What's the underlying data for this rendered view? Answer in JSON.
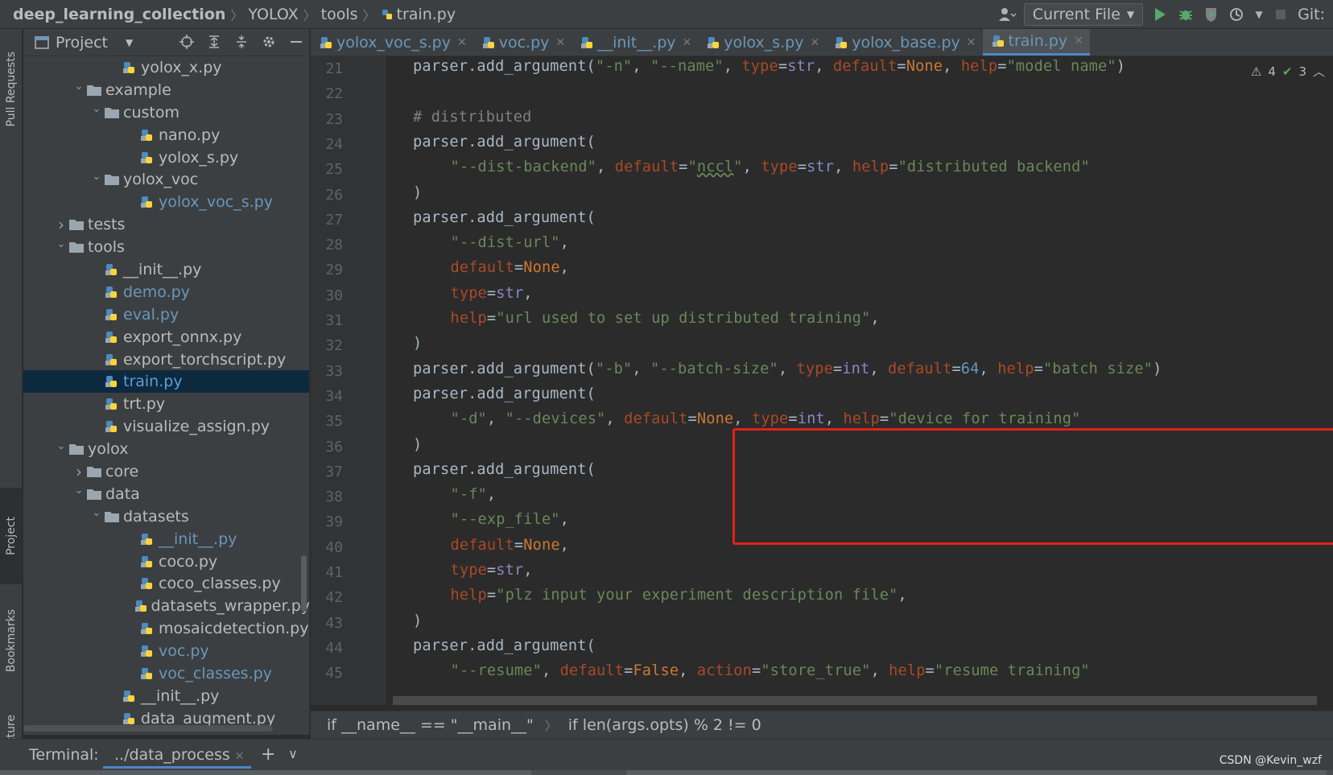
{
  "navbar": {
    "breadcrumb": [
      "deep_learning_collection",
      "YOLOX",
      "tools",
      "train.py"
    ],
    "run_config": "Current File",
    "git_label": "Git:"
  },
  "left_stripe": {
    "tabs": [
      "Pull Requests",
      "Project",
      "Bookmarks",
      "Structure"
    ]
  },
  "project_panel": {
    "title": "Project",
    "tree": [
      {
        "label": "yolox_x.py",
        "indent": 5,
        "type": "py",
        "arrow": ""
      },
      {
        "label": "example",
        "indent": 3,
        "type": "folder",
        "arrow": "open"
      },
      {
        "label": "custom",
        "indent": 4,
        "type": "folder",
        "arrow": "open"
      },
      {
        "label": "nano.py",
        "indent": 6,
        "type": "py",
        "arrow": ""
      },
      {
        "label": "yolox_s.py",
        "indent": 6,
        "type": "py",
        "arrow": ""
      },
      {
        "label": "yolox_voc",
        "indent": 4,
        "type": "folder",
        "arrow": "open"
      },
      {
        "label": "yolox_voc_s.py",
        "indent": 6,
        "type": "py",
        "arrow": "",
        "state": "modified"
      },
      {
        "label": "tests",
        "indent": 2,
        "type": "folder",
        "arrow": "closed"
      },
      {
        "label": "tools",
        "indent": 2,
        "type": "folder",
        "arrow": "open"
      },
      {
        "label": "__init__.py",
        "indent": 4,
        "type": "py",
        "arrow": ""
      },
      {
        "label": "demo.py",
        "indent": 4,
        "type": "py",
        "arrow": "",
        "state": "modified"
      },
      {
        "label": "eval.py",
        "indent": 4,
        "type": "py",
        "arrow": "",
        "state": "modified"
      },
      {
        "label": "export_onnx.py",
        "indent": 4,
        "type": "py",
        "arrow": ""
      },
      {
        "label": "export_torchscript.py",
        "indent": 4,
        "type": "py",
        "arrow": ""
      },
      {
        "label": "train.py",
        "indent": 4,
        "type": "py",
        "arrow": "",
        "state": "active",
        "selected": true
      },
      {
        "label": "trt.py",
        "indent": 4,
        "type": "py",
        "arrow": ""
      },
      {
        "label": "visualize_assign.py",
        "indent": 4,
        "type": "py",
        "arrow": ""
      },
      {
        "label": "yolox",
        "indent": 2,
        "type": "folder",
        "arrow": "open"
      },
      {
        "label": "core",
        "indent": 3,
        "type": "folder",
        "arrow": "closed"
      },
      {
        "label": "data",
        "indent": 3,
        "type": "folder",
        "arrow": "open"
      },
      {
        "label": "datasets",
        "indent": 4,
        "type": "folder",
        "arrow": "open"
      },
      {
        "label": "__init__.py",
        "indent": 6,
        "type": "py",
        "arrow": "",
        "state": "modified"
      },
      {
        "label": "coco.py",
        "indent": 6,
        "type": "py",
        "arrow": ""
      },
      {
        "label": "coco_classes.py",
        "indent": 6,
        "type": "py",
        "arrow": ""
      },
      {
        "label": "datasets_wrapper.py",
        "indent": 6,
        "type": "py",
        "arrow": ""
      },
      {
        "label": "mosaicdetection.py",
        "indent": 6,
        "type": "py",
        "arrow": ""
      },
      {
        "label": "voc.py",
        "indent": 6,
        "type": "py",
        "arrow": "",
        "state": "modified"
      },
      {
        "label": "voc_classes.py",
        "indent": 6,
        "type": "py",
        "arrow": "",
        "state": "modified"
      },
      {
        "label": "__init__.py",
        "indent": 5,
        "type": "py",
        "arrow": ""
      },
      {
        "label": "data_augment.py",
        "indent": 5,
        "type": "py",
        "arrow": ""
      }
    ]
  },
  "tabs": [
    {
      "label": "yolox_voc_s.py",
      "active": false
    },
    {
      "label": "voc.py",
      "active": false
    },
    {
      "label": "__init__.py",
      "active": false
    },
    {
      "label": "yolox_s.py",
      "active": false
    },
    {
      "label": "yolox_base.py",
      "active": false
    },
    {
      "label": "train.py",
      "active": true
    }
  ],
  "editor": {
    "inspections": {
      "warnings": "4",
      "weak_warnings": "3"
    },
    "lines": [
      {
        "n": "21",
        "indent": 1,
        "tokens": [
          [
            "",
            "parser.add_argument("
          ],
          [
            "s",
            "\"-n\""
          ],
          [
            "",
            ", "
          ],
          [
            "s",
            "\"--name\""
          ],
          [
            "",
            ", "
          ],
          [
            "k",
            "type"
          ],
          [
            "",
            "="
          ],
          [
            "b",
            "str"
          ],
          [
            "",
            ", "
          ],
          [
            "k",
            "default"
          ],
          [
            "",
            "="
          ],
          [
            "w",
            "None"
          ],
          [
            "",
            ", "
          ],
          [
            "k",
            "help"
          ],
          [
            "",
            "="
          ],
          [
            "s",
            "\"model name\""
          ],
          [
            "",
            ")"
          ]
        ]
      },
      {
        "n": "22",
        "indent": 1,
        "tokens": []
      },
      {
        "n": "23",
        "indent": 1,
        "tokens": [
          [
            "c",
            "# distributed"
          ]
        ]
      },
      {
        "n": "24",
        "indent": 1,
        "tokens": [
          [
            "",
            "parser.add_argument("
          ]
        ]
      },
      {
        "n": "25",
        "indent": 2,
        "tokens": [
          [
            "s",
            "\"--dist-backend\""
          ],
          [
            "",
            ", "
          ],
          [
            "k",
            "default"
          ],
          [
            "",
            "="
          ],
          [
            "s",
            "\""
          ],
          [
            "sp",
            "nccl"
          ],
          [
            "s",
            "\""
          ],
          [
            "",
            ", "
          ],
          [
            "k",
            "type"
          ],
          [
            "",
            "="
          ],
          [
            "b",
            "str"
          ],
          [
            "",
            ", "
          ],
          [
            "k",
            "help"
          ],
          [
            "",
            "="
          ],
          [
            "s",
            "\"distributed backend\""
          ]
        ]
      },
      {
        "n": "26",
        "indent": 1,
        "tokens": [
          [
            "",
            ")"
          ]
        ]
      },
      {
        "n": "27",
        "indent": 1,
        "tokens": [
          [
            "",
            "parser.add_argument("
          ]
        ]
      },
      {
        "n": "28",
        "indent": 2,
        "tokens": [
          [
            "s",
            "\"--dist-url\""
          ],
          [
            "",
            ","
          ]
        ]
      },
      {
        "n": "29",
        "indent": 2,
        "tokens": [
          [
            "k",
            "default"
          ],
          [
            "",
            "="
          ],
          [
            "w",
            "None"
          ],
          [
            "",
            ","
          ]
        ]
      },
      {
        "n": "30",
        "indent": 2,
        "tokens": [
          [
            "k",
            "type"
          ],
          [
            "",
            "="
          ],
          [
            "b",
            "str"
          ],
          [
            "",
            ","
          ]
        ]
      },
      {
        "n": "31",
        "indent": 2,
        "tokens": [
          [
            "k",
            "help"
          ],
          [
            "",
            "="
          ],
          [
            "s",
            "\"url used to set up distributed training\""
          ],
          [
            "",
            ","
          ]
        ]
      },
      {
        "n": "32",
        "indent": 1,
        "tokens": [
          [
            "",
            ")"
          ]
        ]
      },
      {
        "n": "33",
        "indent": 1,
        "tokens": [
          [
            "",
            "parser.add_argument("
          ],
          [
            "s",
            "\"-b\""
          ],
          [
            "",
            ", "
          ],
          [
            "s",
            "\"--batch-size\""
          ],
          [
            "",
            ", "
          ],
          [
            "k",
            "type"
          ],
          [
            "",
            "="
          ],
          [
            "b",
            "int"
          ],
          [
            "",
            ", "
          ],
          [
            "k",
            "default"
          ],
          [
            "",
            "="
          ],
          [
            "n",
            "64"
          ],
          [
            "",
            ", "
          ],
          [
            "k",
            "help"
          ],
          [
            "",
            "="
          ],
          [
            "s",
            "\"batch size\""
          ],
          [
            "",
            ")"
          ]
        ]
      },
      {
        "n": "34",
        "indent": 1,
        "tokens": [
          [
            "",
            "parser.add_argument("
          ]
        ]
      },
      {
        "n": "35",
        "indent": 2,
        "tokens": [
          [
            "s",
            "\"-d\""
          ],
          [
            "",
            ", "
          ],
          [
            "s",
            "\"--devices\""
          ],
          [
            "",
            ", "
          ],
          [
            "k",
            "default"
          ],
          [
            "",
            "="
          ],
          [
            "w",
            "None"
          ],
          [
            "",
            ", "
          ],
          [
            "k",
            "type"
          ],
          [
            "",
            "="
          ],
          [
            "b",
            "int"
          ],
          [
            "",
            ", "
          ],
          [
            "k",
            "help"
          ],
          [
            "",
            "="
          ],
          [
            "s",
            "\"device for training\""
          ]
        ]
      },
      {
        "n": "36",
        "indent": 1,
        "tokens": [
          [
            "",
            ")"
          ]
        ]
      },
      {
        "n": "37",
        "indent": 1,
        "tokens": [
          [
            "",
            "parser.add_argument("
          ]
        ]
      },
      {
        "n": "38",
        "indent": 2,
        "tokens": [
          [
            "s",
            "\"-f\""
          ],
          [
            "",
            ","
          ]
        ]
      },
      {
        "n": "39",
        "indent": 2,
        "tokens": [
          [
            "s",
            "\"--exp_file\""
          ],
          [
            "",
            ","
          ]
        ]
      },
      {
        "n": "40",
        "indent": 2,
        "tokens": [
          [
            "k",
            "default"
          ],
          [
            "",
            "="
          ],
          [
            "w",
            "None"
          ],
          [
            "",
            ","
          ]
        ]
      },
      {
        "n": "41",
        "indent": 2,
        "tokens": [
          [
            "k",
            "type"
          ],
          [
            "",
            "="
          ],
          [
            "b",
            "str"
          ],
          [
            "",
            ","
          ]
        ]
      },
      {
        "n": "42",
        "indent": 2,
        "tokens": [
          [
            "k",
            "help"
          ],
          [
            "",
            "="
          ],
          [
            "s",
            "\"plz input your experiment description file\""
          ],
          [
            "",
            ","
          ]
        ]
      },
      {
        "n": "43",
        "indent": 1,
        "tokens": [
          [
            "",
            ")"
          ]
        ]
      },
      {
        "n": "44",
        "indent": 1,
        "tokens": [
          [
            "",
            "parser.add_argument("
          ]
        ]
      },
      {
        "n": "45",
        "indent": 2,
        "tokens": [
          [
            "s",
            "\"--resume\""
          ],
          [
            "",
            ", "
          ],
          [
            "k",
            "default"
          ],
          [
            "",
            "="
          ],
          [
            "w",
            "False"
          ],
          [
            "",
            ", "
          ],
          [
            "k",
            "action"
          ],
          [
            "",
            "="
          ],
          [
            "s",
            "\"store_true\""
          ],
          [
            "",
            ", "
          ],
          [
            "k",
            "help"
          ],
          [
            "",
            "="
          ],
          [
            "s",
            "\"resume training\""
          ]
        ]
      }
    ]
  },
  "code_breadcrumb": [
    "if __name__ == \"__main__\"",
    "if len(args.opts) % 2 != 0"
  ],
  "bottom": {
    "terminal_label": "Terminal:",
    "terminal_tab": "../data_process",
    "watermark": "CSDN @Kevin_wzf"
  },
  "colors": {
    "background": "#2b2b2b",
    "panel": "#3c3f41",
    "highlight_box": "#e0221b",
    "selection": "#0d293e",
    "accent": "#4a88c7"
  }
}
